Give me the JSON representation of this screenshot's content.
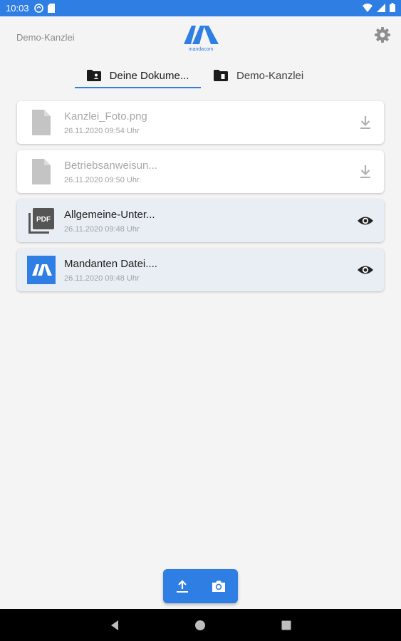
{
  "status_bar": {
    "time": "10:03",
    "left_icons": [
      "sync-icon",
      "sd-card-icon"
    ],
    "right_icons": [
      "wifi-icon",
      "cell-signal-icon",
      "battery-icon"
    ]
  },
  "header": {
    "firm_name": "Demo-Kanzlei",
    "logo_text": "mandacom",
    "settings_icon": "gear-icon"
  },
  "tabs": [
    {
      "label": "Deine Dokume...",
      "icon": "folder-person-icon",
      "active": true
    },
    {
      "label": "Demo-Kanzlei",
      "icon": "folder-doc-icon",
      "active": false
    }
  ],
  "documents": [
    {
      "name": "Kanzlei_Foto.png",
      "date": "26.11.2020 09:54 Uhr",
      "file_icon": "file-icon",
      "action_icon": "download-icon",
      "state": "unread"
    },
    {
      "name": "Betriebsanweisun...",
      "date": "26.11.2020 09:50 Uhr",
      "file_icon": "file-icon",
      "action_icon": "download-icon",
      "state": "unread"
    },
    {
      "name": "Allgemeine-Unter...",
      "date": "26.11.2020 09:48 Uhr",
      "file_icon": "pdf-icon",
      "file_icon_text": "PDF",
      "action_icon": "eye-icon",
      "state": "read"
    },
    {
      "name": "Mandanten Datei....",
      "date": "26.11.2020 09:48 Uhr",
      "file_icon": "mandacom-file-icon",
      "action_icon": "eye-icon",
      "state": "read"
    }
  ],
  "actions": {
    "upload_icon": "upload-icon",
    "camera_icon": "camera-icon"
  },
  "colors": {
    "accent": "#2f7ee3",
    "background": "#f4f4f5",
    "read_card": "#e9eef4"
  }
}
